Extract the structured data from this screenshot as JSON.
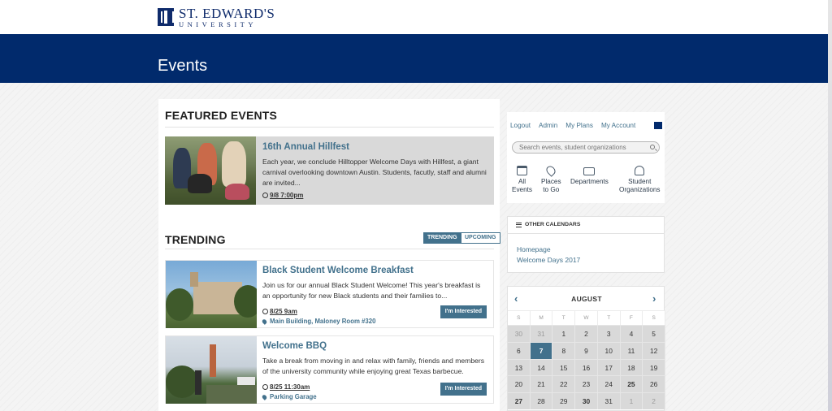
{
  "brand": {
    "line1": "ST. EDWARD'S",
    "line2": "UNIVERSITY",
    "color": "#012a6c",
    "accent": "#42718c"
  },
  "page": {
    "title": "Events"
  },
  "featured": {
    "heading": "FEATURED EVENTS",
    "event": {
      "title": "16th Annual Hillfest",
      "description": "Each year, we conclude Hilltopper Welcome Days with Hillfest, a giant carnival overlooking downtown Austin. Students, facutly, staff and alumni are invited...",
      "time": "9/8 7:00pm"
    }
  },
  "trending": {
    "heading": "TRENDING",
    "tabs": [
      "TRENDING",
      "UPCOMING"
    ],
    "events": [
      {
        "title": "Black Student Welcome Breakfast",
        "description": "Join us for our annual Black Student Welcome! This year's breakfast is an opportunity for new Black students and their families to...",
        "time": "8/25 9am",
        "location": "Main Building, Maloney Room #320",
        "button": "I'm Interested"
      },
      {
        "title": "Welcome BBQ",
        "description": "Take a break from moving in and relax with family, friends and members of the university community while enjoying great Texas barbecue.",
        "time": "8/25 11:30am",
        "location": "Parking Garage",
        "button": "I'm Interested"
      }
    ]
  },
  "sidebar": {
    "links": [
      "Logout",
      "Admin",
      "My Plans",
      "My Account"
    ],
    "search_placeholder": "Search events, student organizations",
    "quick_links": [
      {
        "line1": "All",
        "line2": "Events",
        "icon": "calendar-icon"
      },
      {
        "line1": "Places",
        "line2": "to Go",
        "icon": "map-pin-icon"
      },
      {
        "line1": "Departments",
        "line2": "",
        "icon": "briefcase-icon"
      },
      {
        "line1": "Student",
        "line2": "Organizations",
        "icon": "people-icon"
      }
    ],
    "other_calendars": {
      "heading": "OTHER CALENDARS",
      "links": [
        "Homepage",
        "Welcome Days 2017"
      ]
    },
    "calendar": {
      "month": "AUGUST",
      "weekdays": [
        "S",
        "M",
        "T",
        "W",
        "T",
        "F",
        "S"
      ],
      "days": [
        [
          "30",
          "31",
          "1",
          "2",
          "3",
          "4",
          "5"
        ],
        [
          "6",
          "7",
          "8",
          "9",
          "10",
          "11",
          "12"
        ],
        [
          "13",
          "14",
          "15",
          "16",
          "17",
          "18",
          "19"
        ],
        [
          "20",
          "21",
          "22",
          "23",
          "24",
          "25",
          "26"
        ],
        [
          "27",
          "28",
          "29",
          "30",
          "31",
          "1",
          "2"
        ]
      ],
      "today": "7"
    }
  }
}
